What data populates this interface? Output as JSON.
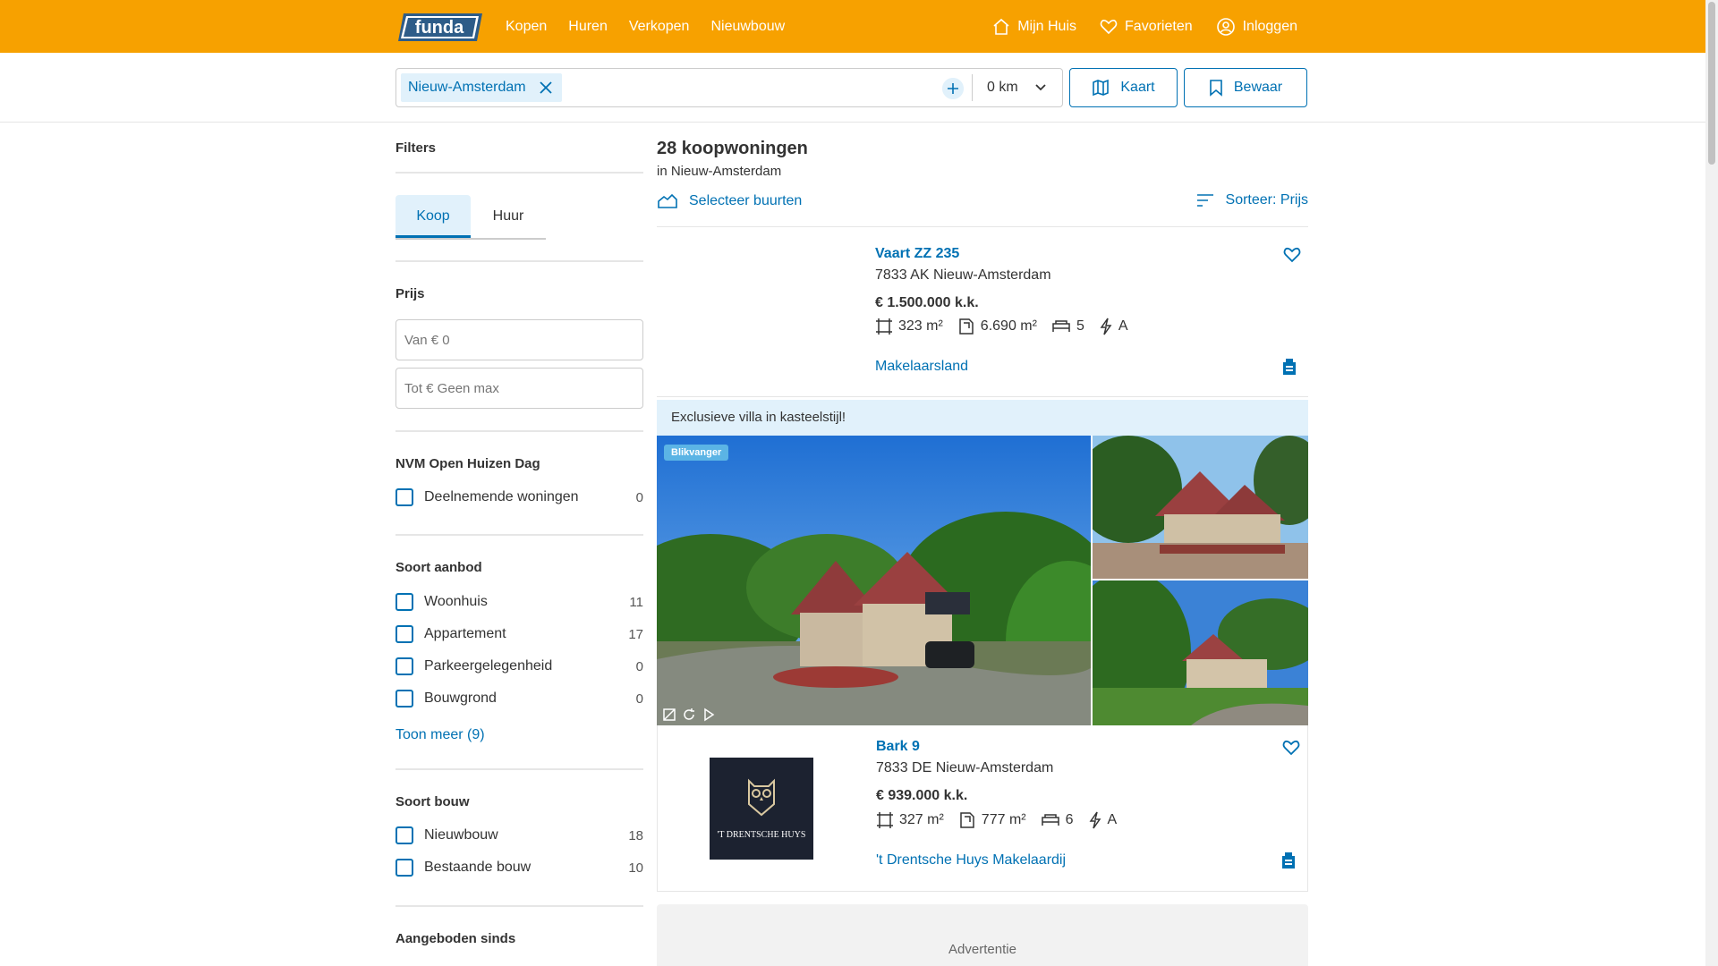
{
  "header": {
    "logo_text": "funda",
    "nav": [
      "Kopen",
      "Huren",
      "Verkopen",
      "Nieuwbouw"
    ],
    "mijn_huis": "Mijn Huis",
    "favorieten": "Favorieten",
    "inloggen": "Inloggen"
  },
  "search": {
    "location_chip": "Nieuw-Amsterdam",
    "radius": "0 km",
    "kaart_label": "Kaart",
    "bewaar_label": "Bewaar"
  },
  "filters": {
    "title": "Filters",
    "tab_koop": "Koop",
    "tab_huur": "Huur",
    "prijs_title": "Prijs",
    "van_placeholder": "Van € 0",
    "tot_placeholder": "Tot € Geen max",
    "open_huizen_title": "NVM Open Huizen Dag",
    "open_huizen_items": [
      {
        "label": "Deelnemende woningen",
        "count": "0"
      }
    ],
    "soort_aanbod_title": "Soort aanbod",
    "soort_aanbod_items": [
      {
        "label": "Woonhuis",
        "count": "11"
      },
      {
        "label": "Appartement",
        "count": "17"
      },
      {
        "label": "Parkeergelegenheid",
        "count": "0"
      },
      {
        "label": "Bouwgrond",
        "count": "0"
      }
    ],
    "toon_meer": "Toon meer (9)",
    "soort_bouw_title": "Soort bouw",
    "soort_bouw_items": [
      {
        "label": "Nieuwbouw",
        "count": "18"
      },
      {
        "label": "Bestaande bouw",
        "count": "10"
      }
    ],
    "aangeboden_title": "Aangeboden sinds"
  },
  "results": {
    "title": "28 koopwoningen",
    "subtitle": "in Nieuw-Amsterdam",
    "buurten_label": "Selecteer buurten",
    "sort_label": "Sorteer: Prijs"
  },
  "listings": [
    {
      "address": "Vaart ZZ 235",
      "city": "7833 AK Nieuw-Amsterdam",
      "price": "€ 1.500.000 k.k.",
      "living_area": "323 m²",
      "plot_area": "6.690 m²",
      "rooms": "5",
      "energy": "A",
      "agent": "Makelaarsland"
    },
    {
      "address": "Bark 9",
      "city": "7833 DE Nieuw-Amsterdam",
      "price": "€ 939.000 k.k.",
      "living_area": "327 m²",
      "plot_area": "777 m²",
      "rooms": "6",
      "energy": "A",
      "agent": "'t Drentsche Huys Makelaardij",
      "agent_logo_text": "'T DRENTSCHE HUYS"
    }
  ],
  "featured": {
    "banner": "Exclusieve villa in kasteelstijl!",
    "badge": "Blikvanger"
  },
  "ad_label": "Advertentie",
  "colors": {
    "brand_orange": "#f7a100",
    "link_blue": "#0071b3",
    "highlight_blue": "#e1f1fb"
  }
}
